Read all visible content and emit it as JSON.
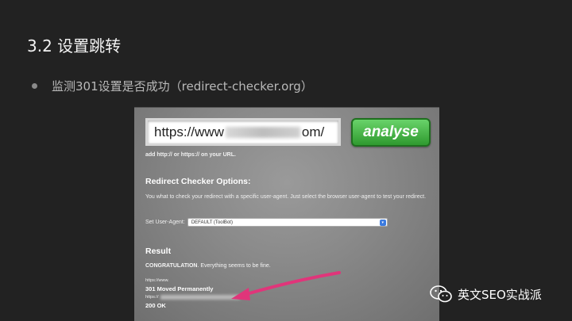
{
  "slide": {
    "title": "3.2 设置跳转",
    "bullet": "监测301设置是否成功（redirect-checker.org）"
  },
  "tool": {
    "url_prefix": "https://www",
    "url_suffix": "om/",
    "analyse_label": "analyse",
    "hint": "add http:// or https:// on your URL.",
    "options_heading": "Redirect Checker Options:",
    "options_desc": "You what to check your redirect with a specific user-agent. Just select the browser user-agent to test your redirect.",
    "ua_label": "Set User-Agent:",
    "ua_value": "DEFAULT (ToolBot)",
    "result_heading": "Result",
    "congrats_strong": "CONGRATULATION",
    "congrats_rest": ". Everything seems to be fine.",
    "result_url1": "https://www.",
    "result_status1": "301 Moved Permanently",
    "result_url2": "https://",
    "result_status2": "200 OK"
  },
  "watermark": {
    "text": "英文SEO实战派",
    "icon": "wechat-icon"
  },
  "colors": {
    "background": "#222222",
    "analyse_button": "#3fae3f",
    "arrow": "#e0357a"
  }
}
